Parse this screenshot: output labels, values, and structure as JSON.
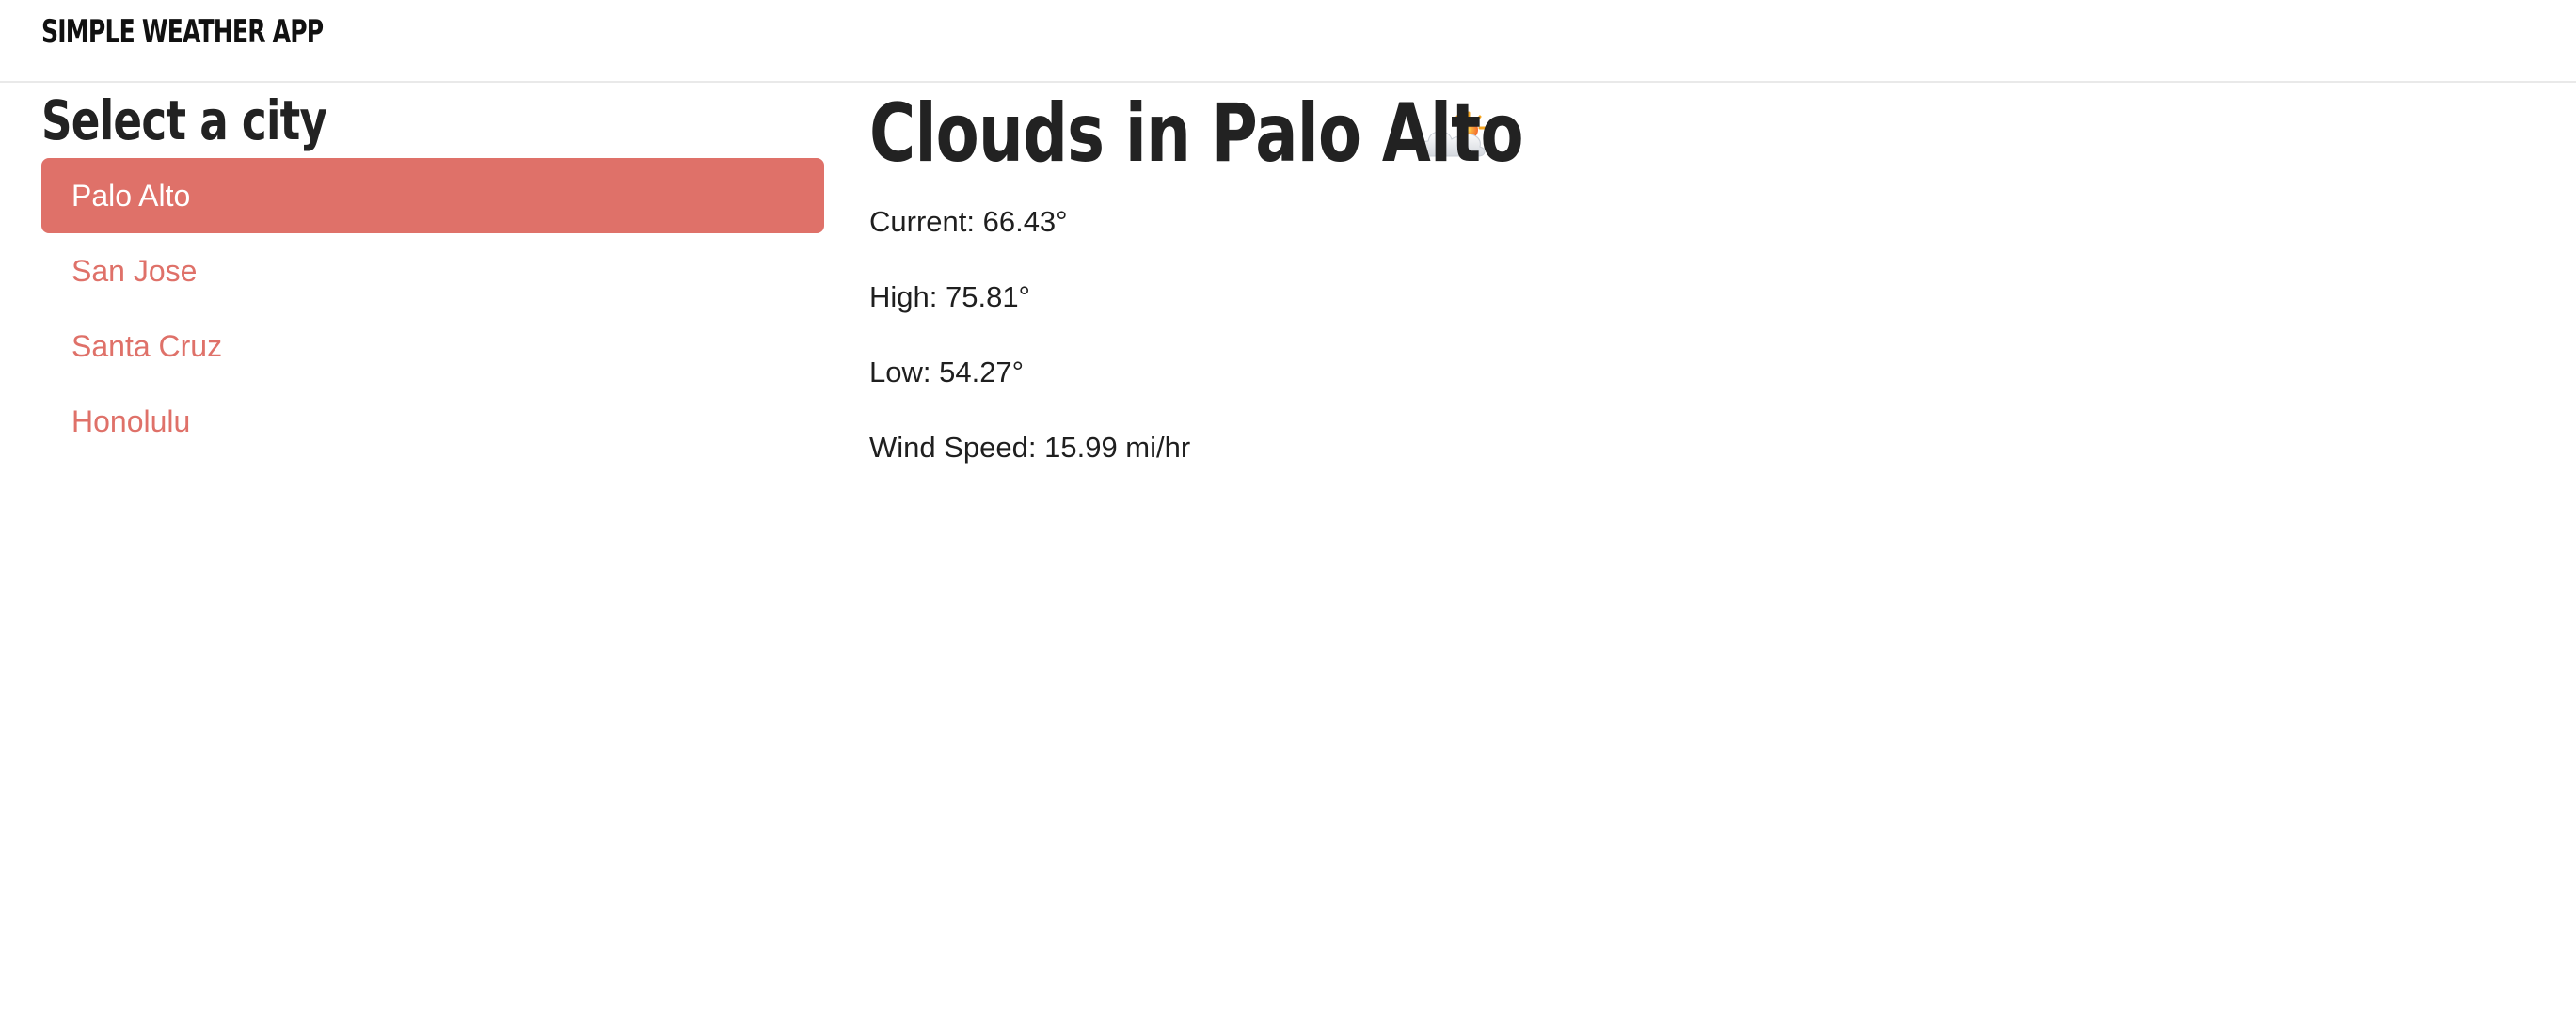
{
  "navbar": {
    "brand": "SIMPLE WEATHER APP"
  },
  "sidebar": {
    "title": "Select a city",
    "items": [
      {
        "label": "Palo Alto",
        "active": true
      },
      {
        "label": "San Jose",
        "active": false
      },
      {
        "label": "Santa Cruz",
        "active": false
      },
      {
        "label": "Honolulu",
        "active": false
      }
    ]
  },
  "main": {
    "headline": "Clouds in Palo Alto",
    "icon": "cloud-sun-icon",
    "current": "Current: 66.43°",
    "high": "High: 75.81°",
    "low": "Low: 54.27°",
    "wind": "Wind Speed: 15.99 mi/hr"
  },
  "colors": {
    "accent": "#df7169",
    "text": "#1f1f1f"
  }
}
